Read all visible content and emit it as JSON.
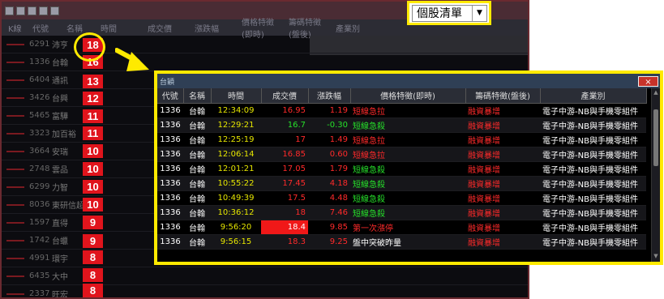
{
  "selector": {
    "value": "個股清單",
    "arrow": "▼"
  },
  "popup": {
    "title": "台穎",
    "close": "×",
    "columns": [
      "代號",
      "名稱",
      "時間",
      "成交價",
      "漲跌幅",
      "價格特徵(即時)",
      "籌碼特徵(盤後)",
      "產業別"
    ],
    "rows": [
      {
        "code": "1336",
        "name": "台翰",
        "time": "12:34:09",
        "price": "16.95",
        "chg": "1.19",
        "price_feat": "短線急拉",
        "chip_feat": "融資暴增",
        "industry": "電子中游-NB與手機零組件"
      },
      {
        "code": "1336",
        "name": "台翰",
        "time": "12:29:21",
        "price": "16.7",
        "chg": "-0.30",
        "price_feat": "短線急殺",
        "chip_feat": "融資暴增",
        "industry": "電子中游-NB與手機零組件"
      },
      {
        "code": "1336",
        "name": "台翰",
        "time": "12:25:19",
        "price": "17",
        "chg": "1.49",
        "price_feat": "短線急拉",
        "chip_feat": "融資暴增",
        "industry": "電子中游-NB與手機零組件"
      },
      {
        "code": "1336",
        "name": "台翰",
        "time": "12:06:14",
        "price": "16.85",
        "chg": "0.60",
        "price_feat": "短線急拉",
        "chip_feat": "融資暴增",
        "industry": "電子中游-NB與手機零組件"
      },
      {
        "code": "1336",
        "name": "台翰",
        "time": "12:01:21",
        "price": "17.05",
        "chg": "1.79",
        "price_feat": "短線急殺",
        "chip_feat": "融資暴增",
        "industry": "電子中游-NB與手機零組件"
      },
      {
        "code": "1336",
        "name": "台翰",
        "time": "10:55:22",
        "price": "17.45",
        "chg": "4.18",
        "price_feat": "短線急殺",
        "chip_feat": "融資暴增",
        "industry": "電子中游-NB與手機零組件"
      },
      {
        "code": "1336",
        "name": "台翰",
        "time": "10:49:39",
        "price": "17.5",
        "chg": "4.48",
        "price_feat": "短線急殺",
        "chip_feat": "融資暴增",
        "industry": "電子中游-NB與手機零組件"
      },
      {
        "code": "1336",
        "name": "台翰",
        "time": "10:36:12",
        "price": "18",
        "chg": "7.46",
        "price_feat": "短線急殺",
        "chip_feat": "融資暴增",
        "industry": "電子中游-NB與手機零組件"
      },
      {
        "code": "1336",
        "name": "台翰",
        "time": "9:56:20",
        "price": "18.4",
        "chg": "9.85",
        "price_feat": "第一次漲停",
        "chip_feat": "融資暴增",
        "industry": "電子中游-NB與手機零組件"
      },
      {
        "code": "1336",
        "name": "台翰",
        "time": "9:56:15",
        "price": "18.3",
        "chg": "9.25",
        "price_feat": "盤中突破昨量",
        "chip_feat": "融資暴增",
        "industry": "電子中游-NB與手機零組件"
      }
    ]
  },
  "background": {
    "header": [
      "K線",
      "代號",
      "名稱",
      "時間",
      "成交價",
      "漲跌幅",
      "價格特徵(即時)",
      "籌碼特徵(盤後)",
      "產業別"
    ],
    "codes": [
      "6291",
      "1336",
      "6404",
      "3426",
      "5465",
      "3323",
      "3664",
      "2748",
      "6299",
      "8036",
      "1597",
      "1742",
      "4991",
      "6435",
      "2337"
    ],
    "names": [
      "沛亨",
      "台翰",
      "通訊",
      "台興",
      "富驊",
      "加百裕",
      "安瑞",
      "雲品",
      "力智",
      "東研信超",
      "直得",
      "台蠟",
      "環宇",
      "大中",
      "旺宏"
    ],
    "badges": [
      "18",
      "16",
      "13",
      "12",
      "11",
      "11",
      "10",
      "10",
      "10",
      "10",
      "9",
      "9",
      "8",
      "8",
      "8"
    ]
  }
}
